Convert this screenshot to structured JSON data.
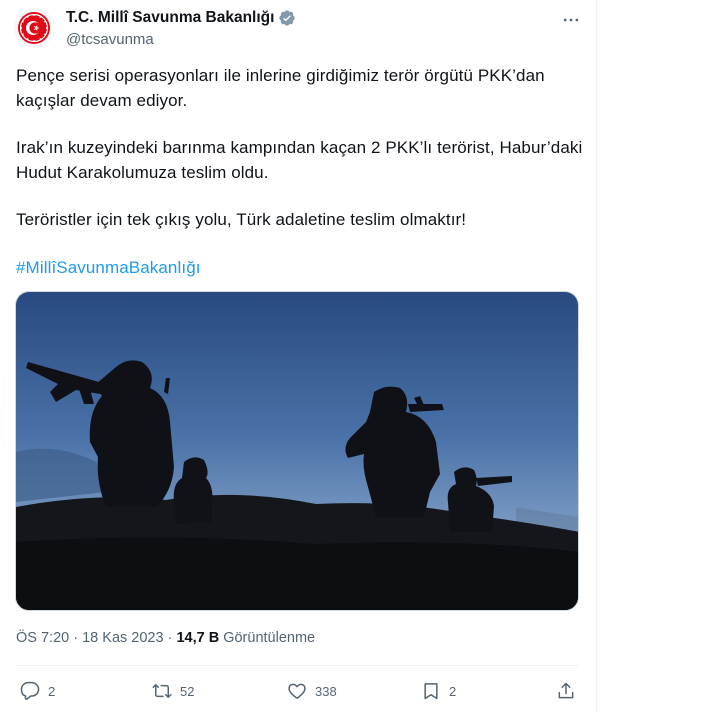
{
  "account": {
    "name": "T.C. Millî Savunma Bakanlığı",
    "handle": "@tcsavunma",
    "verified_color": "#829aab"
  },
  "tweet": {
    "lines": [
      "Pençe serisi operasyonları ile inlerine girdiğimiz terör örgütü PKK’dan",
      "kaçışlar devam ediyor.",
      "Irak’ın kuzeyindeki barınma kampından kaçan 2 PKK’lı terörist, Habur’daki",
      "Hudut Karakolumuza teslim oldu.",
      "Teröristler için tek çıkış yolu, Türk adaletine teslim olmaktır!"
    ],
    "hashtag": "#MillîSavunmaBakanlığı"
  },
  "meta": {
    "time": "ÖS 7:20",
    "separator": "·",
    "date": "18 Kas 2023",
    "views_count": "14,7 B",
    "views_label": "Görüntülenme"
  },
  "actions": {
    "replies": "2",
    "reposts": "52",
    "likes": "338",
    "bookmarks": "2"
  },
  "icons": {
    "more": "more-horizontal-icon",
    "reply": "reply-icon",
    "repost": "repost-icon",
    "like": "heart-icon",
    "bookmark": "bookmark-icon",
    "share": "share-icon"
  },
  "colors": {
    "accent": "#1d9bf0",
    "logo_red": "#e30a17",
    "secondary_text": "#536471"
  }
}
